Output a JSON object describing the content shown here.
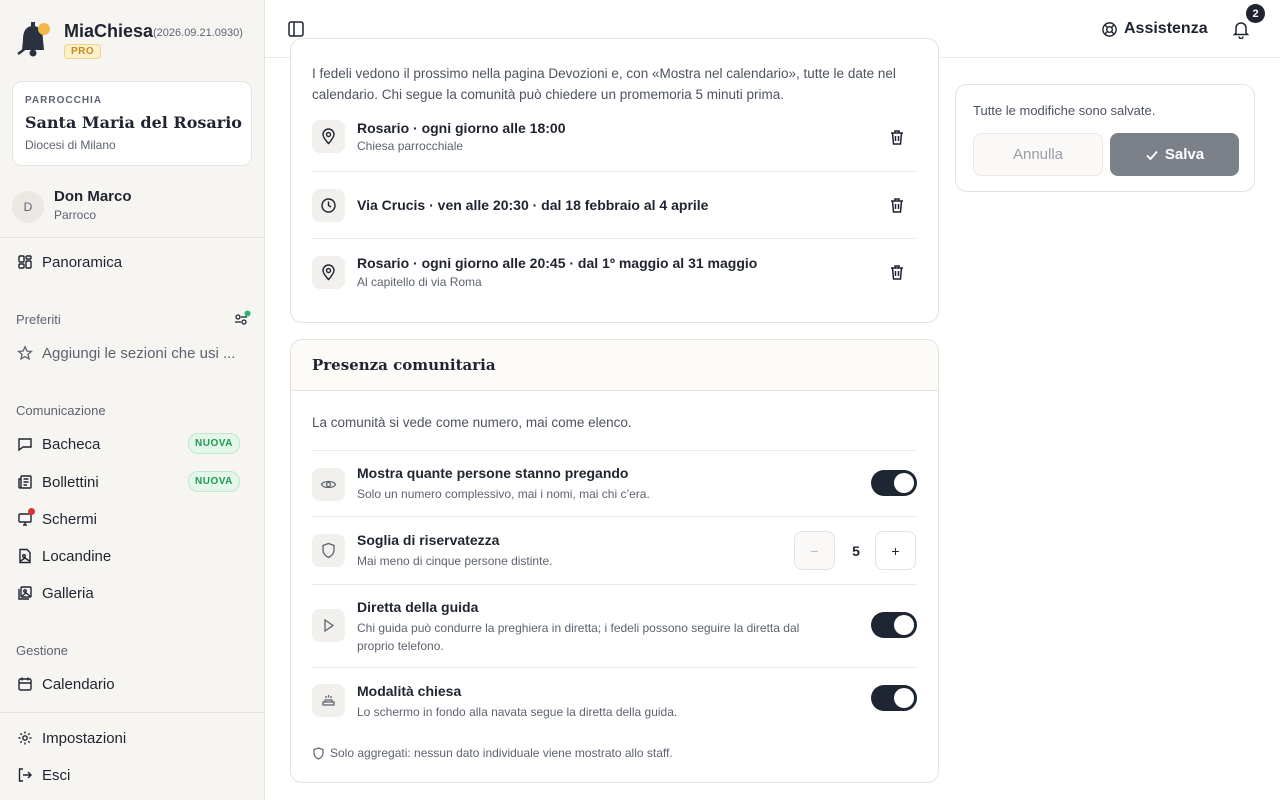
{
  "brand": {
    "name": "MiaChiesa",
    "version": "(2026.09.21.0930)",
    "tier": "PRO"
  },
  "parish": {
    "label": "PARROCCHIA",
    "name": "Santa Maria del Rosario",
    "diocese": "Diocesi di Milano"
  },
  "user": {
    "initial": "D",
    "name": "Don Marco",
    "role": "Parroco"
  },
  "nav": {
    "overview": "Panoramica",
    "favorites_title": "Preferiti",
    "favorites_add": "Aggiungi le sezioni che usi ...",
    "communication_title": "Comunicazione",
    "communication": [
      {
        "label": "Bacheca",
        "badge": "NUOVA"
      },
      {
        "label": "Bollettini",
        "badge": "NUOVA"
      },
      {
        "label": "Schermi"
      },
      {
        "label": "Locandine"
      },
      {
        "label": "Galleria"
      }
    ],
    "management_title": "Gestione",
    "calendar": "Calendario",
    "settings": "Impostazioni",
    "logout": "Esci"
  },
  "topbar": {
    "help": "Assistenza",
    "notifications_count": "2"
  },
  "devotions": {
    "intro": "I fedeli vedono il prossimo nella pagina Devozioni e, con «Mostra nel calendario», tutte le date nel calendario. Chi segue la comunità può chiedere un promemoria 5 minuti prima.",
    "items": [
      {
        "title": "Rosario · ogni giorno alle 18:00",
        "subtitle": "Chiesa parrocchiale",
        "icon": "map-pin-icon"
      },
      {
        "title": "Via Crucis · ven alle 20:30 · dal 18 febbraio al 4 aprile",
        "subtitle": "",
        "icon": "clock-icon"
      },
      {
        "title": "Rosario · ogni giorno alle 20:45 · dal 1º maggio al 31 maggio",
        "subtitle": "Al capitello di via Roma",
        "icon": "map-pin-icon"
      }
    ]
  },
  "presence": {
    "title": "Presenza comunitaria",
    "intro": "La comunità si vede come numero, mai come elenco.",
    "show_count": {
      "title": "Mostra quante persone stanno pregando",
      "subtitle": "Solo un numero complessivo, mai i nomi, mai chi c’era.",
      "enabled": true
    },
    "threshold": {
      "title": "Soglia di riservatezza",
      "subtitle": "Mai meno di cinque persone distinte.",
      "value": "5",
      "minus": "−",
      "plus": "+"
    },
    "live": {
      "title": "Diretta della guida",
      "subtitle": "Chi guida può condurre la preghiera in diretta; i fedeli possono seguire la diretta dal proprio telefono.",
      "enabled": true
    },
    "church_mode": {
      "title": "Modalità chiesa",
      "subtitle": "Lo schermo in fondo alla navata segue la diretta della guida.",
      "enabled": true
    },
    "footnote": "Solo aggregati: nessun dato individuale viene mostrato allo staff."
  },
  "save_panel": {
    "status": "Tutte le modifiche sono salvate.",
    "cancel": "Annulla",
    "save": "Salva"
  },
  "colors": {
    "toggle_on": "#1f2633",
    "accent_pro": "#c98a1c",
    "badge_new": "#1e9a54",
    "notification_dot": "#d8352f"
  }
}
